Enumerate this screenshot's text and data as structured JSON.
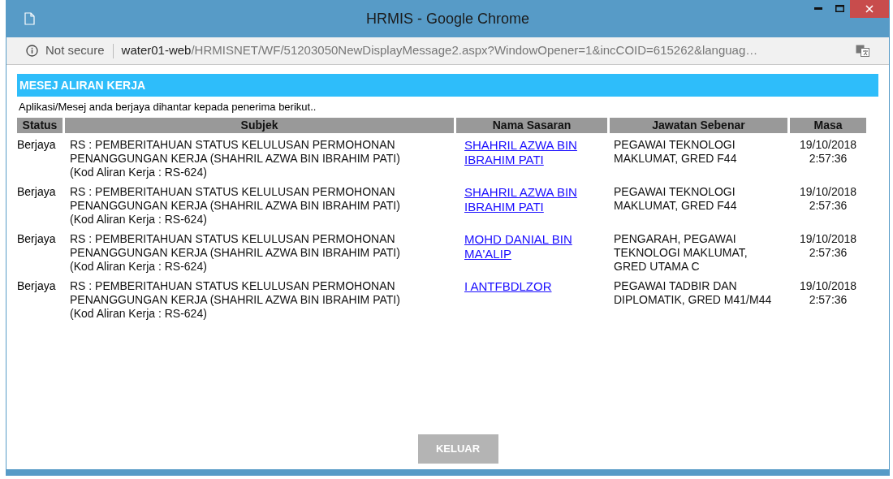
{
  "window": {
    "title": "HRMIS - Google Chrome"
  },
  "address_bar": {
    "security": "Not secure",
    "host": "water01-web",
    "path": "/HRMISNET/WF/51203050NewDisplayMessage2.aspx?WindowOpener=1&incCOID=615262&languag…"
  },
  "section_title": "MESEJ ALIRAN KERJA",
  "message": "Aplikasi/Mesej anda berjaya dihantar kepada penerima berikut..",
  "table": {
    "columns": [
      "Status",
      "Subjek",
      "Nama Sasaran",
      "Jawatan Sebenar",
      "Masa"
    ],
    "rows": [
      {
        "status": "Berjaya",
        "subject": "RS : PEMBERITAHUAN STATUS KELULUSAN PERMOHONAN PENANGGUNGAN KERJA (SHAHRIL AZWA BIN IBRAHIM PATI) (Kod Aliran Kerja : RS-624)",
        "name": "SHAHRIL AZWA BIN IBRAHIM PATI",
        "position": "PEGAWAI TEKNOLOGI MAKLUMAT, GRED F44",
        "time": "19/10/2018 2:57:36"
      },
      {
        "status": "Berjaya",
        "subject": "RS : PEMBERITAHUAN STATUS KELULUSAN PERMOHONAN PENANGGUNGAN KERJA (SHAHRIL AZWA BIN IBRAHIM PATI) (Kod Aliran Kerja : RS-624)",
        "name": "SHAHRIL AZWA BIN IBRAHIM PATI",
        "position": "PEGAWAI TEKNOLOGI MAKLUMAT, GRED F44",
        "time": "19/10/2018 2:57:36"
      },
      {
        "status": "Berjaya",
        "subject": "RS : PEMBERITAHUAN STATUS KELULUSAN PERMOHONAN PENANGGUNGAN KERJA (SHAHRIL AZWA BIN IBRAHIM PATI) (Kod Aliran Kerja : RS-624)",
        "name": "MOHD DANIAL BIN MA'ALIP",
        "position": "PENGARAH, PEGAWAI TEKNOLOGI MAKLUMAT, GRED UTAMA C",
        "time": "19/10/2018 2:57:36"
      },
      {
        "status": "Berjaya",
        "subject": "RS : PEMBERITAHUAN STATUS KELULUSAN PERMOHONAN PENANGGUNGAN KERJA (SHAHRIL AZWA BIN IBRAHIM PATI) (Kod Aliran Kerja : RS-624)",
        "name": "I ANTFBDLZOR",
        "position": "PEGAWAI TADBIR DAN DIPLOMATIK, GRED M41/M44",
        "time": "19/10/2018 2:57:36"
      }
    ]
  },
  "button": "KELUAR"
}
